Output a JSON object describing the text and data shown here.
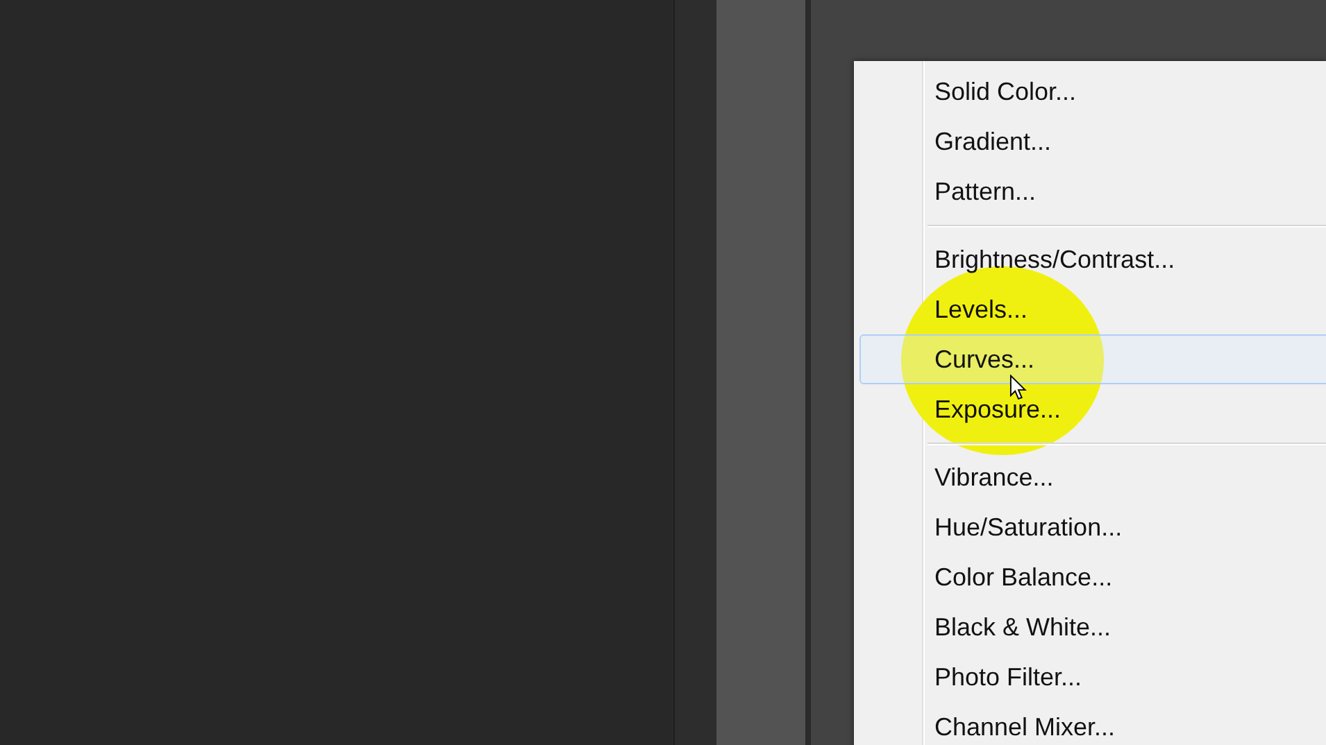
{
  "menu": {
    "groups": [
      {
        "items": [
          {
            "label": "Solid Color...",
            "selected": false
          },
          {
            "label": "Gradient...",
            "selected": false
          },
          {
            "label": "Pattern...",
            "selected": false
          }
        ]
      },
      {
        "items": [
          {
            "label": "Brightness/Contrast...",
            "selected": false
          },
          {
            "label": "Levels...",
            "selected": false
          },
          {
            "label": "Curves...",
            "selected": true
          },
          {
            "label": "Exposure...",
            "selected": false
          }
        ]
      },
      {
        "items": [
          {
            "label": "Vibrance...",
            "selected": false
          },
          {
            "label": "Hue/Saturation...",
            "selected": false
          },
          {
            "label": "Color Balance...",
            "selected": false
          },
          {
            "label": "Black & White...",
            "selected": false
          },
          {
            "label": "Photo Filter...",
            "selected": false
          },
          {
            "label": "Channel Mixer...",
            "selected": false
          }
        ]
      }
    ]
  }
}
